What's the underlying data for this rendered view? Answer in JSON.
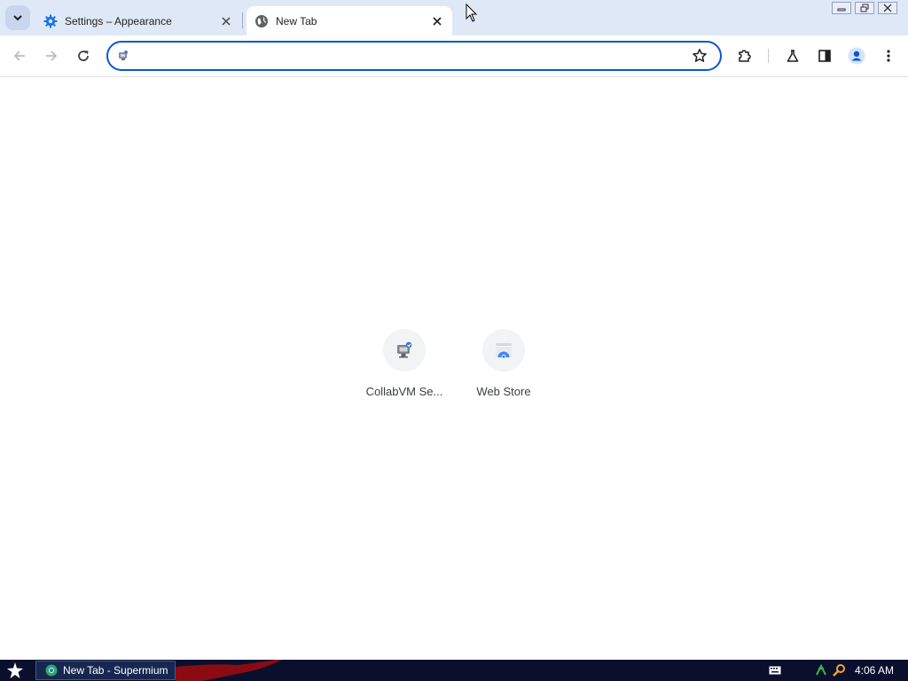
{
  "browser": {
    "tabs": [
      {
        "title": "Settings – Appearance",
        "icon": "gear-icon",
        "active": false
      },
      {
        "title": "New Tab",
        "icon": "globe-icon",
        "active": true
      }
    ],
    "omnibox": {
      "value": "",
      "placeholder": ""
    },
    "accent_color": "#0b57d0",
    "tabstrip_color": "#dfe8f7"
  },
  "new_tab": {
    "shortcuts": [
      {
        "label": "CollabVM Se...",
        "icon": "collabvm-icon"
      },
      {
        "label": "Web Store",
        "icon": "web-store-icon"
      }
    ]
  },
  "taskbar": {
    "task_label": "New Tab - Supermium",
    "clock": "4:06 AM",
    "background_color": "#0a0f2e"
  }
}
